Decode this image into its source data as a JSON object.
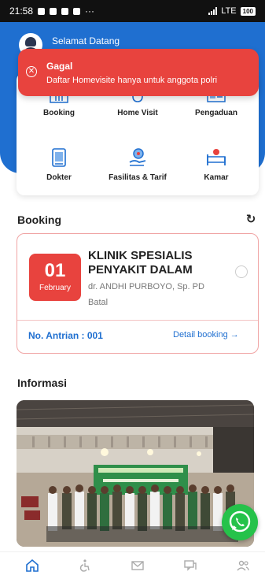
{
  "status_bar": {
    "time": "21:58",
    "dots": "···",
    "network": "LTE",
    "battery": "100"
  },
  "header": {
    "welcome": "Selamat Datang"
  },
  "toast": {
    "title": "Gagal",
    "message": "Daftar Homevisite hanya untuk anggota polri",
    "color": "#e8433e"
  },
  "menu": {
    "items": [
      {
        "label": "Booking",
        "icon": "calendar-icon"
      },
      {
        "label": "Home Visit",
        "icon": "home-visit-icon"
      },
      {
        "label": "Pengaduan",
        "icon": "complaint-icon"
      },
      {
        "label": "Dokter",
        "icon": "doctor-icon"
      },
      {
        "label": "Fasilitas & Tarif",
        "icon": "facility-icon"
      },
      {
        "label": "Kamar",
        "icon": "bed-icon"
      }
    ]
  },
  "booking": {
    "section_title": "Booking",
    "day": "01",
    "month": "February",
    "clinic": "KLINIK SPESIALIS PENYAKIT DALAM",
    "doctor": "dr. ANDHI PURBOYO, Sp. PD",
    "status": "Batal",
    "queue": "No. Antrian : 001",
    "detail_link": "Detail booking →"
  },
  "info": {
    "section_title": "Informasi"
  },
  "bottom_nav": {
    "items": [
      "home-icon",
      "accessibility-icon",
      "mail-icon",
      "chat-icon",
      "users-icon"
    ]
  },
  "colors": {
    "primary": "#1f6fd0",
    "danger": "#e8433e",
    "whatsapp": "#25c24a"
  }
}
